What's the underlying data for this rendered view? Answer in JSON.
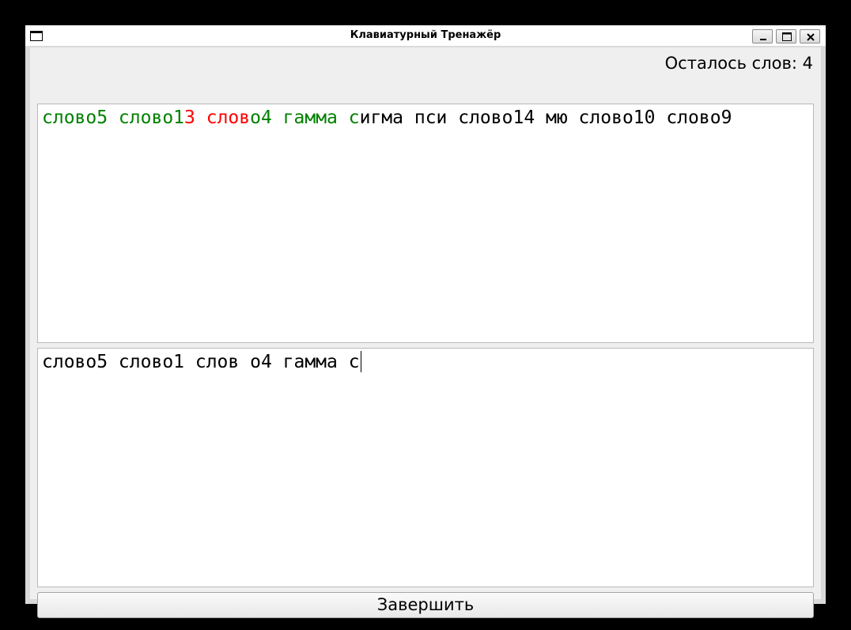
{
  "window": {
    "title": "Клавиатурный Тренажёр"
  },
  "counter": {
    "text": "Осталось слов: 4"
  },
  "target_text": {
    "segments": [
      {
        "text": "слово5 слово1",
        "status": "correct"
      },
      {
        "text": "3",
        "status": "error"
      },
      {
        "text": " ",
        "status": "correct"
      },
      {
        "text": "слов",
        "status": "error"
      },
      {
        "text": "о4 гамма с",
        "status": "correct"
      },
      {
        "text": "игма пси слово14 мю слово10 слово9",
        "status": "pending"
      }
    ]
  },
  "input_text": {
    "value": "слово5 слово1 слов о4 гамма с"
  },
  "finish_button": {
    "label": "Завершить"
  },
  "colors": {
    "correct": "#008000",
    "error": "#ff0000",
    "pending": "#000000"
  },
  "icons": {
    "app": "window-icon",
    "minimize": "minimize-icon",
    "maximize": "maximize-icon",
    "close": "close-icon"
  }
}
